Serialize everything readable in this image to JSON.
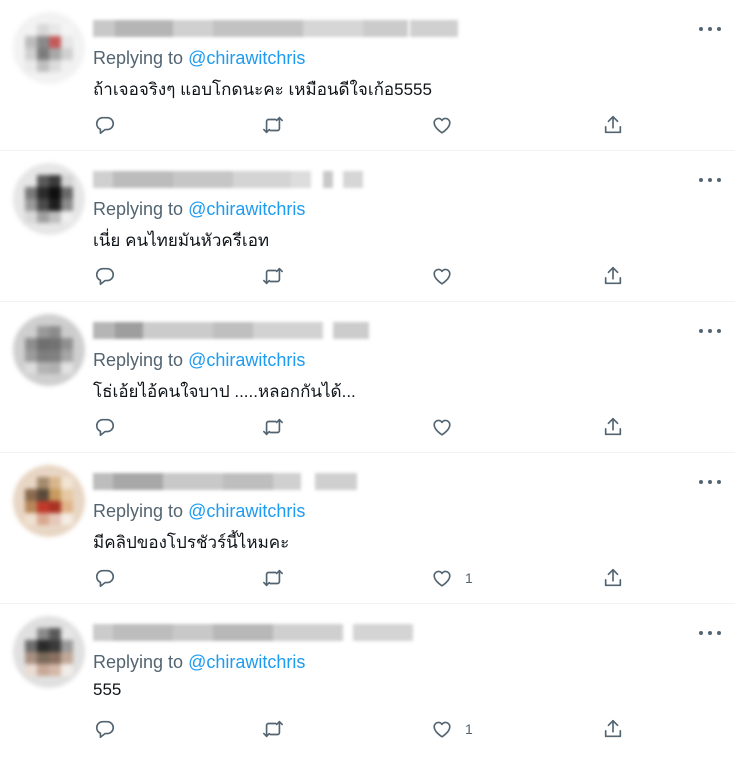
{
  "feed": {
    "tweets": [
      {
        "replying_prefix": "Replying to",
        "replying_handle": "@chirawitchris",
        "text": "ถ้าเจอจริงๆ แอบโกดนะคะ เหมือนดีใจเก้อ5555",
        "likes": "",
        "avatar_colors": [
          "#f2f2f2",
          "#d8d8d8",
          "#e8e8e8",
          "#f4f4f4",
          "#bdbdbd",
          "#8a8a8a",
          "#c45a5a",
          "#e6e6e6",
          "#cfcfcf",
          "#7c7c7c",
          "#a8a8a8",
          "#d0d0d0",
          "#eaeaea",
          "#bfbfbf",
          "#dcdcdc",
          "#f0f0f0"
        ]
      },
      {
        "replying_prefix": "Replying to",
        "replying_handle": "@chirawitchris",
        "text": "เนี่ย คนไทยมันหัวครีเอท",
        "likes": "",
        "avatar_colors": [
          "#e6e6e6",
          "#5a5a5a",
          "#3b3b3b",
          "#d4d4d4",
          "#7a7a7a",
          "#2b2b2b",
          "#0f0f0f",
          "#6a6a6a",
          "#9a9a9a",
          "#4b4b4b",
          "#1e1e1e",
          "#8b8b8b",
          "#d8d8d8",
          "#a0a0a0",
          "#bdbdbd",
          "#eeeeee"
        ]
      },
      {
        "replying_prefix": "Replying to",
        "replying_handle": "@chirawitchris",
        "text": "โธ่เอ้ยไอ้คนใจบาป .....หลอกกันได้...",
        "likes": "",
        "avatar_colors": [
          "#cfcfcf",
          "#9a9a9a",
          "#8c8c8c",
          "#cccccc",
          "#8e8e8e",
          "#6f6f6f",
          "#727272",
          "#909090",
          "#9b9b9b",
          "#7e7e7e",
          "#808080",
          "#a6a6a6",
          "#dcdcdc",
          "#b4b4b4",
          "#b0b0b0",
          "#e2e2e2"
        ]
      },
      {
        "replying_prefix": "Replying to",
        "replying_handle": "@chirawitchris",
        "text": "มีคลิปของโปรชัวร์นี้ไหมคะ",
        "likes": "1",
        "avatar_colors": [
          "#e8d6c4",
          "#a48a6e",
          "#d8b58c",
          "#f1e4d2",
          "#8a6a4e",
          "#5a4a3a",
          "#c79a5e",
          "#e6c9a4",
          "#b8875a",
          "#c0392b",
          "#a83224",
          "#e0b48a",
          "#f0e0d0",
          "#d8a890",
          "#e6c8b8",
          "#f4ece4"
        ]
      },
      {
        "replying_prefix": "Replying to",
        "replying_handle": "@chirawitchris",
        "text": "555",
        "likes": "1",
        "avatar_colors": [
          "#e0e0e0",
          "#8a8a8a",
          "#5a5a5a",
          "#e6e6e6",
          "#6e6e6e",
          "#2a2a2a",
          "#3a3a3a",
          "#9a9a9a",
          "#a89080",
          "#7a6a5a",
          "#8a7060",
          "#c0a898",
          "#eadcd4",
          "#c8a898",
          "#d4b8a8",
          "#f2ece8"
        ]
      }
    ]
  },
  "icons": {
    "reply": "reply-icon",
    "retweet": "retweet-icon",
    "like": "like-icon",
    "share": "share-icon",
    "more": "more-icon"
  },
  "colors": {
    "handle": "#1d9bf0",
    "muted": "#536471",
    "text": "#0f1419"
  }
}
